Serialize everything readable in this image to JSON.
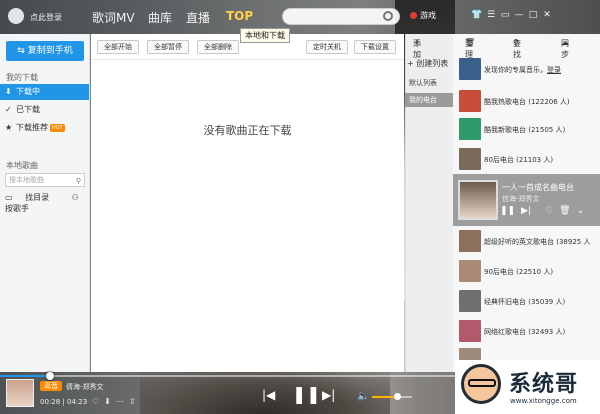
{
  "topbar": {
    "login": "点此登录",
    "nav": [
      "歌词MV",
      "曲库",
      "直播",
      "TOP"
    ],
    "tooltip": "本地和下载",
    "game": "游戏",
    "window_buttons": [
      "shirt-icon",
      "menu-icon",
      "mini-icon",
      "minimize-icon",
      "maximize-icon",
      "close-icon"
    ]
  },
  "left": {
    "copy_button": "复制到手机",
    "download_title": "我的下载",
    "items": [
      {
        "label": "下载中",
        "icon": "download-icon",
        "active": true
      },
      {
        "label": "已下载",
        "icon": "check-icon",
        "active": false
      },
      {
        "label": "下载推荐",
        "icon": "star-icon",
        "active": false,
        "badge": "HOT"
      }
    ],
    "local_title": "本地歌曲",
    "search_placeholder": "搜本地歌曲",
    "find_dir": "找目录",
    "by_singer": "按歌手"
  },
  "center": {
    "buttons": [
      "全部开始",
      "全部暂停",
      "全部删除",
      "定时关机",
      "下载设置"
    ],
    "empty_message": "没有歌曲正在下载"
  },
  "playlists": {
    "add": "添加",
    "new_list": "创建列表",
    "tabs": [
      "默认列表",
      "我的电台"
    ],
    "selected_tab": "我的电台"
  },
  "right": {
    "header": [
      "添加",
      "整理",
      "查找",
      "同步"
    ],
    "songs": [
      {
        "title": "发现你的专属音乐，",
        "link": "登录",
        "color": "#3a5f8a"
      },
      {
        "title": "酷我热歌电台 (122206 人)",
        "color": "#c74f3a"
      },
      {
        "title": "酷我新歌电台 (21505 人)",
        "color": "#2e9a6a"
      },
      {
        "title": "80后电台 (21103 人)",
        "color": "#7b6b5c"
      }
    ],
    "active": {
      "title": "一人一首成名曲电台",
      "subtitle": "信海-郑秀文"
    },
    "songs2": [
      {
        "title": "超级好听的英文歌电台 (38925 人",
        "color": "#8c6f5c"
      },
      {
        "title": "90后电台 (22510 人)",
        "color": "#a88a77"
      },
      {
        "title": "经典怀旧电台 (35039 人)",
        "color": "#6f6f6f"
      },
      {
        "title": "网络红歌电台 (32493 人)",
        "color": "#b05a6c"
      },
      {
        "title": "",
        "color": "#9d8a7a"
      }
    ]
  },
  "player": {
    "quality": "高音",
    "artist": "倩海-郑秀文",
    "current_time": "00:28",
    "total_time": "04:23",
    "progress": 0.08,
    "volume": 0.6
  },
  "watermark": {
    "title": "系统哥",
    "url": "www.xitongge.com"
  }
}
